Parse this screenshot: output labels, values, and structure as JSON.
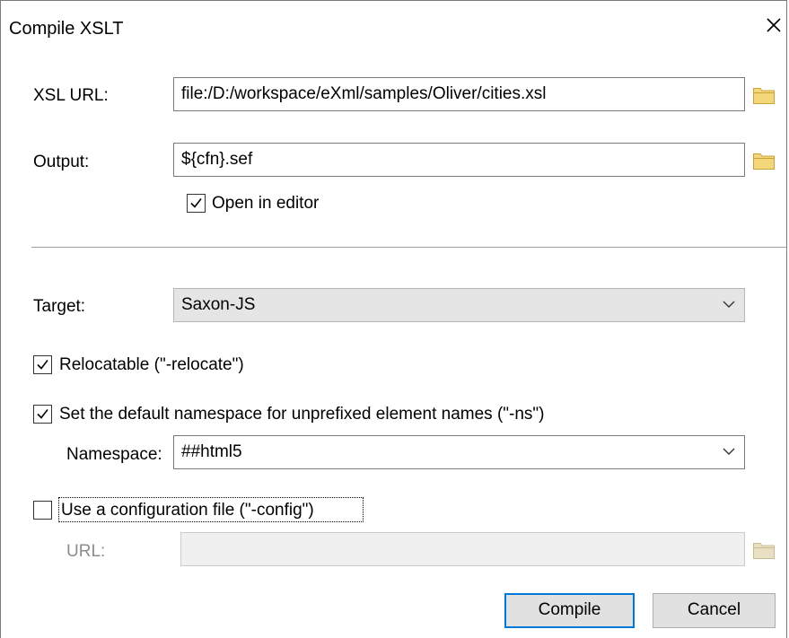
{
  "dialog": {
    "title": "Compile XSLT",
    "close_icon": "close-icon"
  },
  "xsl_url": {
    "label": "XSL URL:",
    "value": "file:/D:/workspace/eXml/samples/Oliver/cities.xsl",
    "browse_icon": "folder-icon"
  },
  "output": {
    "label": "Output:",
    "value": "${cfn}.sef",
    "browse_icon": "folder-icon",
    "open_in_editor": {
      "label": "Open in editor",
      "checked": true
    }
  },
  "target": {
    "label": "Target:",
    "selected": "Saxon-JS"
  },
  "relocatable": {
    "label": "Relocatable (\"-relocate\")",
    "checked": true
  },
  "default_namespace": {
    "label": "Set the default namespace for unprefixed element names (\"-ns\")",
    "checked": true,
    "namespace_label": "Namespace:",
    "namespace_value": "##html5"
  },
  "config_file": {
    "label": "Use a configuration file (\"-config\")",
    "checked": false,
    "url_label": "URL:",
    "url_value": "",
    "browse_icon": "folder-icon"
  },
  "buttons": {
    "compile": "Compile",
    "cancel": "Cancel"
  },
  "colors": {
    "accent": "#0078d7",
    "folder": "#e8c45a",
    "folder_disabled": "#d9cfae"
  }
}
